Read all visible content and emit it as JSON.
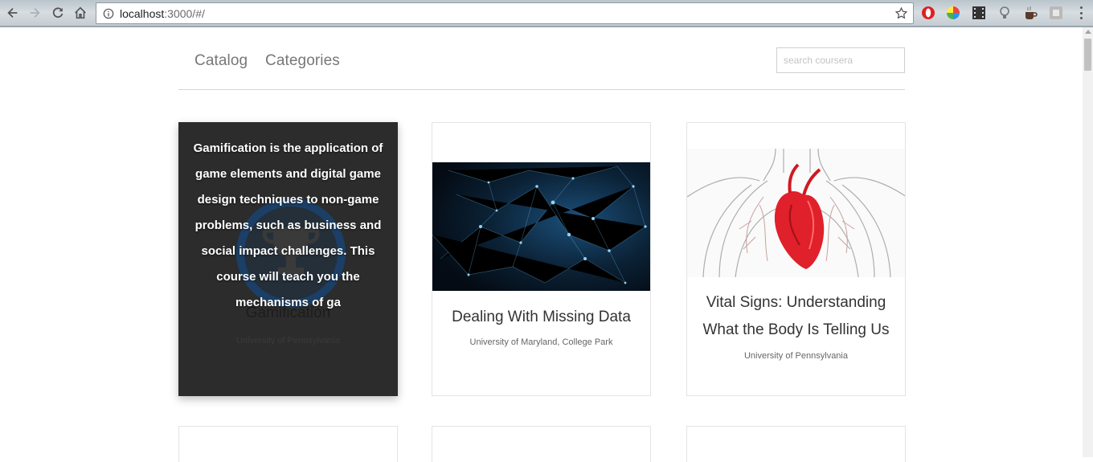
{
  "browser": {
    "url_host": "localhost",
    "url_rest": ":3000/#/",
    "extensions": [
      {
        "name": "opera-icon",
        "color": "#e02020"
      },
      {
        "name": "color-picker-icon",
        "color": "#ff9800"
      },
      {
        "name": "film-icon",
        "color": "#333333"
      },
      {
        "name": "lightbulb-icon",
        "color": "#888888"
      },
      {
        "name": "coffee-cup-icon",
        "color": "#5a3a2a"
      },
      {
        "name": "extension-icon",
        "color": "#b9b9b9"
      }
    ]
  },
  "nav": {
    "catalog": "Catalog",
    "categories": "Categories",
    "search_placeholder": "search coursera"
  },
  "cards": [
    {
      "title": "Gamification",
      "university": "University of Pennsylvania",
      "description": "Gamification is the application of game elements and digital game design techniques to non-game problems, such as business and social impact challenges. This course will teach you the mechanisms of ga",
      "hovered": true,
      "image": "trophy-logo"
    },
    {
      "title": "Dealing With Missing Data",
      "university": "University of Maryland, College Park",
      "image": "network-nodes-image"
    },
    {
      "title": "Vital Signs: Understanding What the Body Is Telling Us",
      "university": "University of Pennsylvania",
      "image": "anatomy-heart-lungs-image"
    }
  ],
  "colors": {
    "accent_dark": "#2c2c2c",
    "network_blue": "#1f6fa8",
    "heart_red": "#e0202a"
  }
}
